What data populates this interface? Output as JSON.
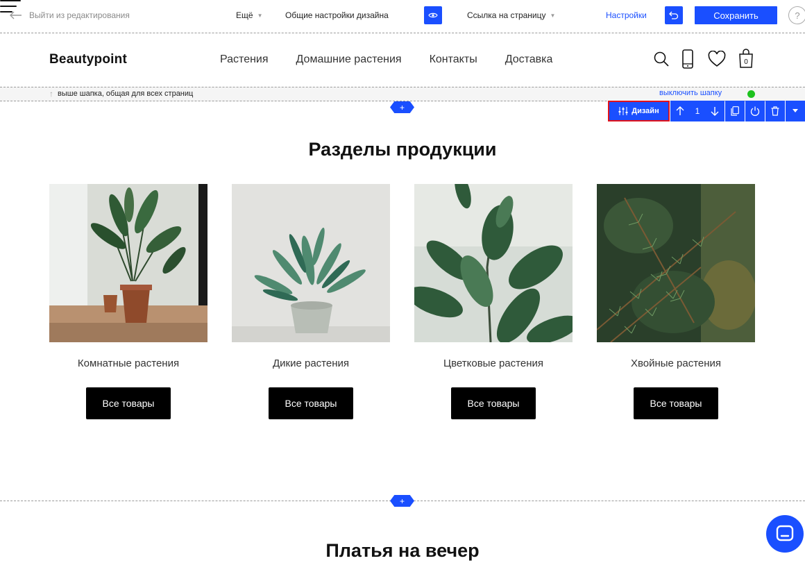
{
  "editor_toolbar": {
    "exit_label": "Выйти из редактирования",
    "more_label": "Ещё",
    "design_settings_label": "Общие настройки дизайна",
    "page_link_label": "Ссылка на страницу",
    "settings_label": "Настройки",
    "save_label": "Сохранить",
    "help_label": "?"
  },
  "site_header": {
    "logo": "Beautypoint",
    "nav": [
      "Растения",
      "Домашние растения",
      "Контакты",
      "Доставка"
    ],
    "cart_count": "0"
  },
  "header_strip": {
    "note": "выше шапка, общая для всех страниц",
    "toggle_label": "выключить шапку",
    "status_color": "#1ec21e"
  },
  "block_tools": {
    "design_label": "Дизайн",
    "position": "1"
  },
  "section1": {
    "title": "Разделы продукции",
    "cards": [
      {
        "name": "Комнатные растения",
        "button": "Все товары"
      },
      {
        "name": "Дикие растения",
        "button": "Все товары"
      },
      {
        "name": "Цветковые растения",
        "button": "Все товары"
      },
      {
        "name": "Хвойные растения",
        "button": "Все товары"
      }
    ]
  },
  "section2": {
    "title": "Платья на вечер"
  },
  "colors": {
    "accent": "#1a4fff",
    "highlight_border": "#e0121b"
  }
}
